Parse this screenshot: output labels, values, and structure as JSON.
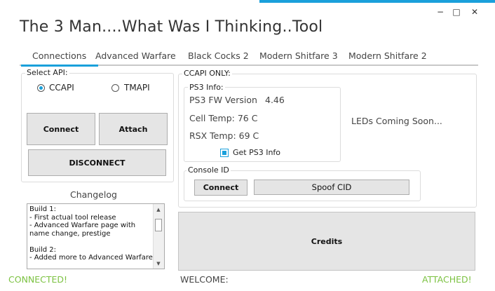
{
  "window": {
    "title": "The 3 Man....What Was I Thinking..Tool",
    "controls": {
      "minimize": "−",
      "maximize": "□",
      "close": "✕"
    }
  },
  "tabs": [
    {
      "label": "Connections",
      "active": true
    },
    {
      "label": "Advanced Warfare"
    },
    {
      "label": "Black Cocks 2"
    },
    {
      "label": "Modern Shitfare 3"
    },
    {
      "label": "Modern Shitfare 2"
    }
  ],
  "select_api": {
    "label": "Select API:",
    "options": [
      {
        "label": "CCAPI",
        "checked": true
      },
      {
        "label": "TMAPI",
        "checked": false
      }
    ],
    "connect_label": "Connect",
    "attach_label": "Attach",
    "disconnect_label": "DISCONNECT"
  },
  "changelog": {
    "label": "Changelog",
    "text": "Build 1:\n- First actual tool release\n- Advanced Warfare page with name change, prestige\n\nBuild 2:\n- Added more to Advanced Warfare"
  },
  "ccapi": {
    "label": "CCAPI ONLY:",
    "ps3_info": {
      "label": "PS3 Info:",
      "fw_label": "PS3 FW Version",
      "fw_value": "4.46",
      "cell_temp": "Cell Temp:  76 C",
      "rsx_temp": "RSX Temp:  69 C",
      "get_info_label": "Get PS3 Info",
      "get_info_checked": true
    },
    "leds_text": "LEDs Coming Soon...",
    "console_id": {
      "label": "Console ID",
      "connect_label": "Connect",
      "spoof_label": "Spoof CID"
    }
  },
  "credits_label": "Credits",
  "status": {
    "left": "CONNECTED!",
    "center": "WELCOME:",
    "right": "ATTACHED!",
    "color": "#7cc242"
  },
  "accent_color": "#1aa0db"
}
